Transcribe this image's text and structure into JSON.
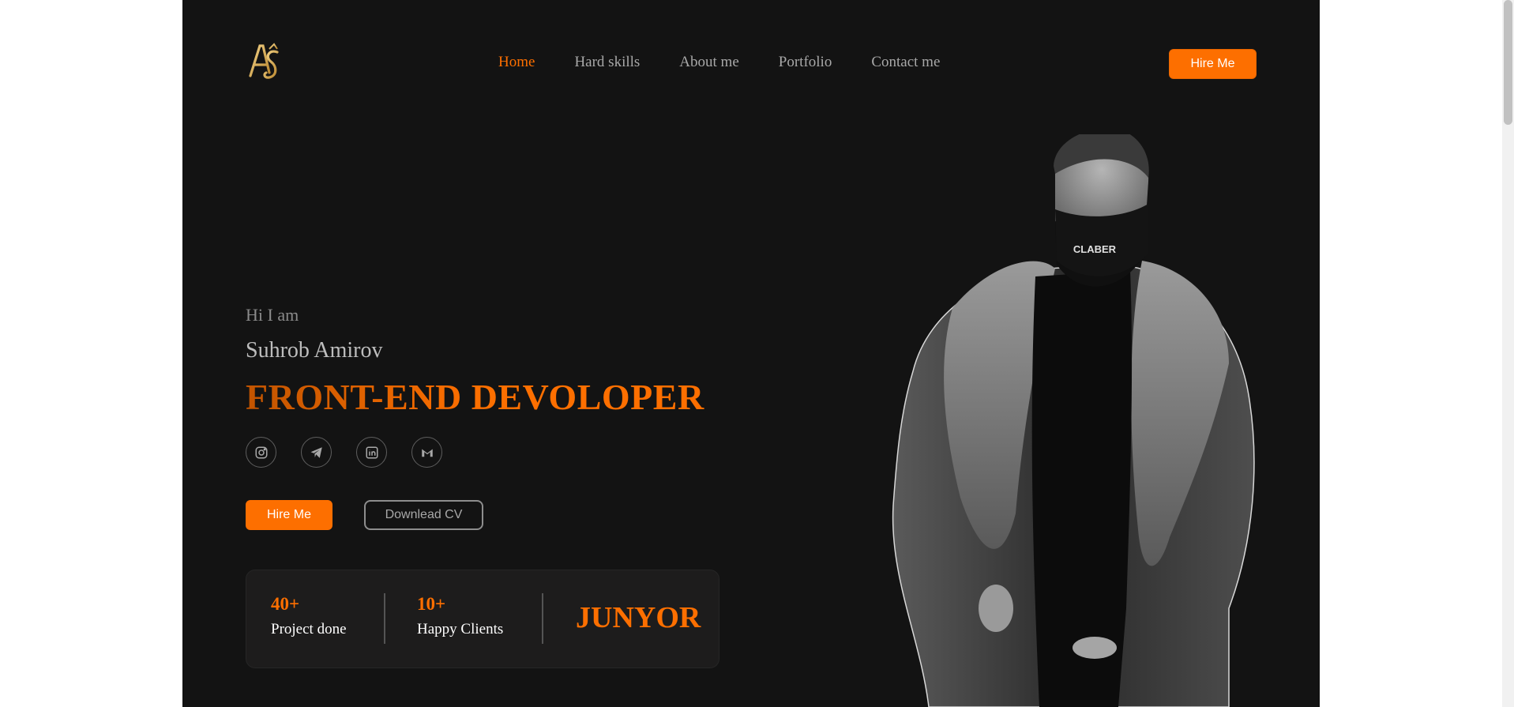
{
  "brand": {
    "logo_icon": "as-monogram-logo",
    "accent_color": "#fd6f00",
    "background_color": "#131313"
  },
  "nav": {
    "items": [
      {
        "label": "Home",
        "active": true
      },
      {
        "label": "Hard skills"
      },
      {
        "label": "About me"
      },
      {
        "label": "Portfolio"
      },
      {
        "label": "Contact me"
      }
    ],
    "hire_label": "Hire Me"
  },
  "hero": {
    "greeting": "Hi I am",
    "name": "Suhrob Amirov",
    "title": "FRONT-END DEVOLOPER",
    "socials": [
      "instagram-icon",
      "telegram-icon",
      "linkedin-icon",
      "gmail-icon"
    ],
    "hire_label": "Hire Me",
    "cv_label": "Downlead CV"
  },
  "stats": {
    "projects": {
      "value": "40+",
      "label": "Project done"
    },
    "clients": {
      "value": "10+",
      "label": "Happy Clients"
    },
    "level": "JUNYOR"
  },
  "photo": {
    "icon": "portrait-photo"
  }
}
